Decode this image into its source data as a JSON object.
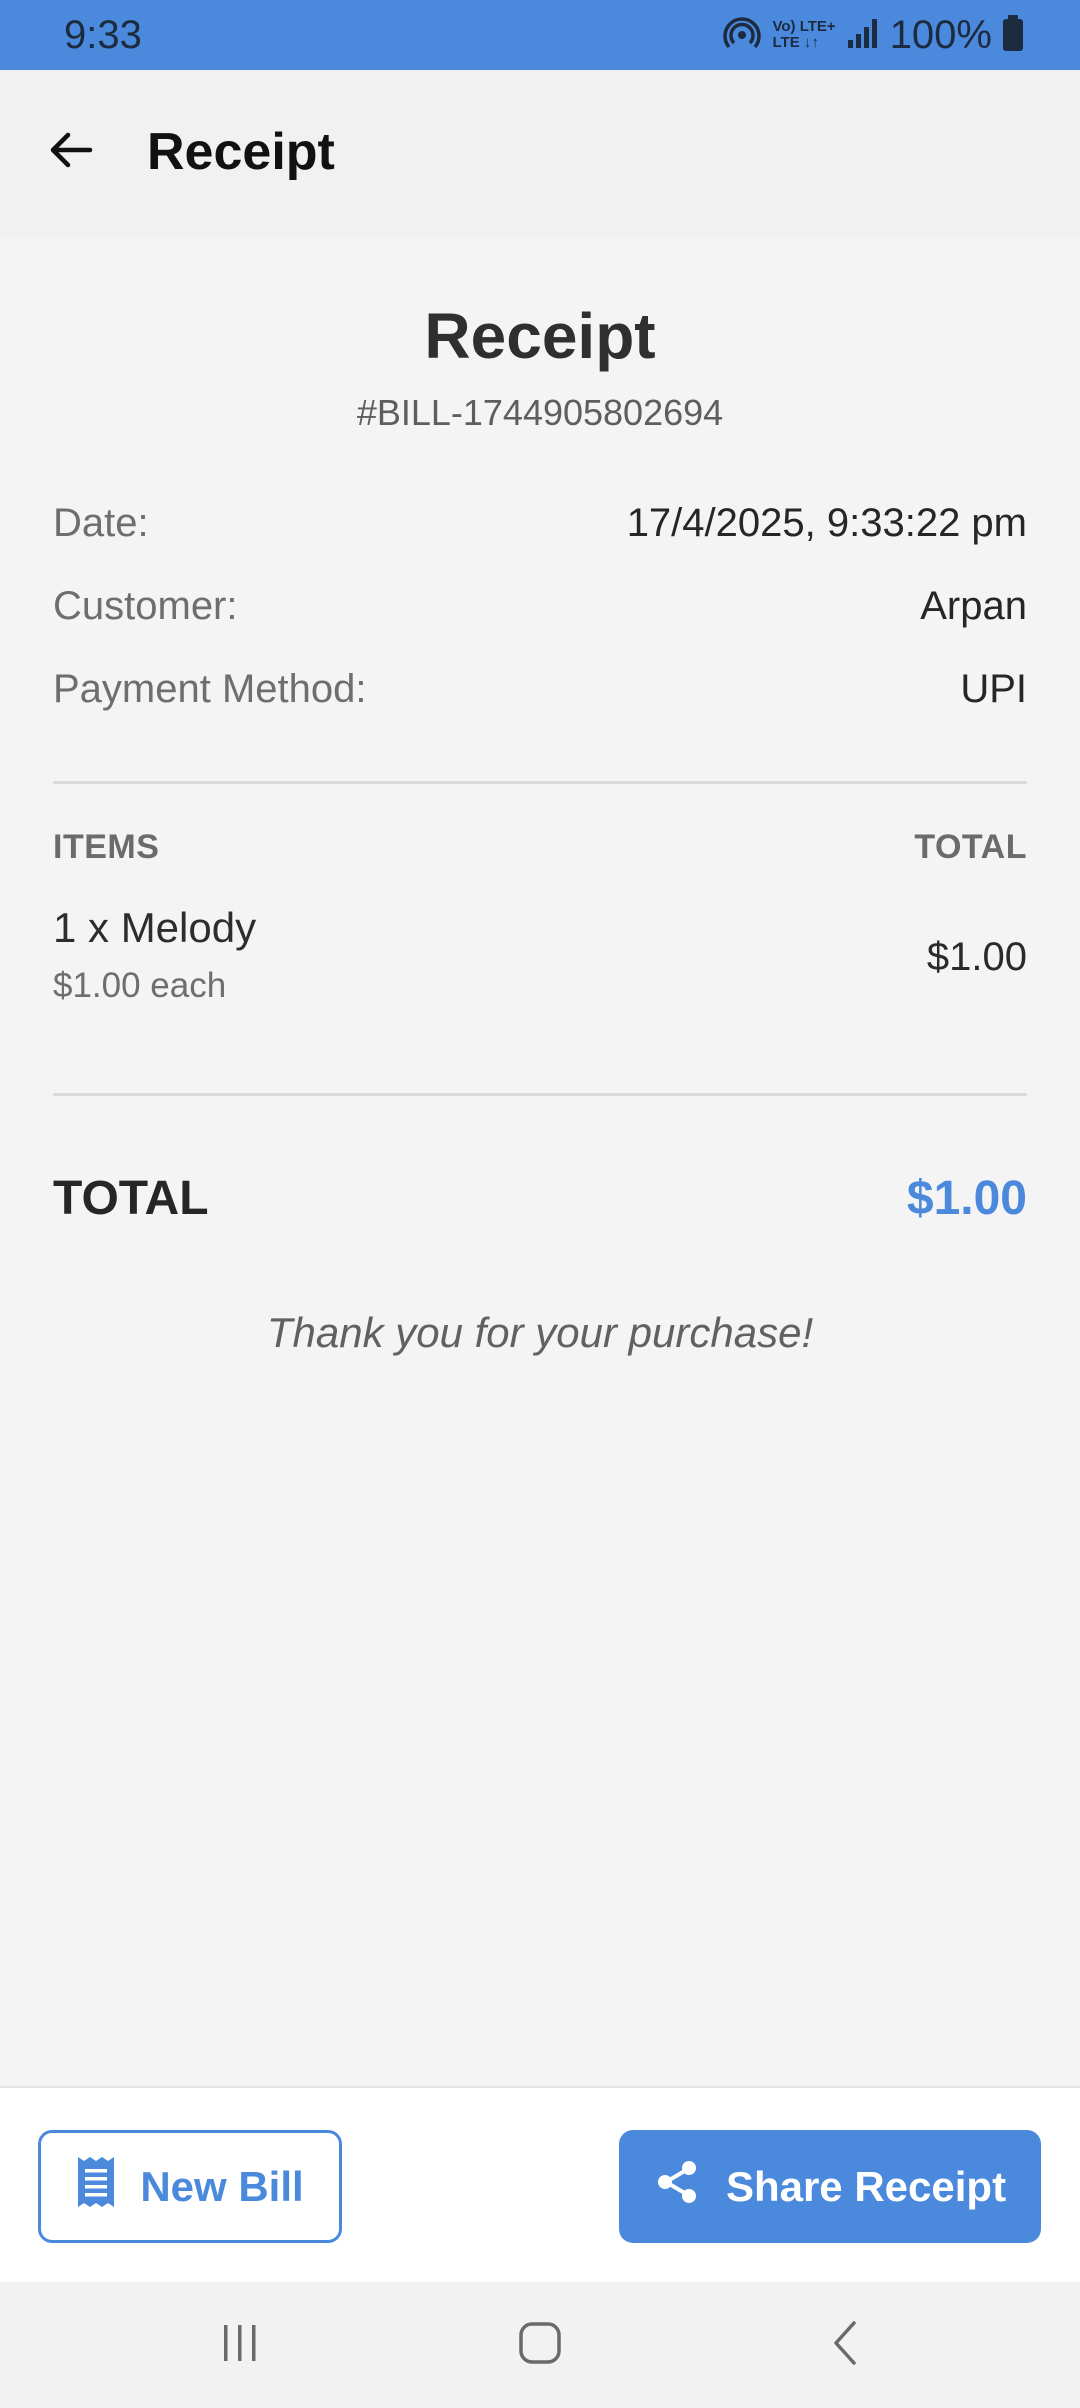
{
  "status_bar": {
    "time": "9:33",
    "lte_top": "Vo) LTE+",
    "lte_bottom": "LTE ↓↑",
    "battery": "100%",
    "icons": [
      "hotspot-icon",
      "volte-icon",
      "signal-icon",
      "battery-icon"
    ]
  },
  "app_bar": {
    "title": "Receipt",
    "back_icon": "arrow-left-icon"
  },
  "receipt": {
    "heading": "Receipt",
    "number": "#BILL-1744905802694",
    "date_label": "Date:",
    "date_value": "17/4/2025, 9:33:22 pm",
    "customer_label": "Customer:",
    "customer_value": "Arpan",
    "payment_label": "Payment Method:",
    "payment_value": "UPI",
    "items_header": "ITEMS",
    "total_header": "TOTAL",
    "items": [
      {
        "name": "1 x Melody",
        "unit_price": "$1.00 each",
        "total": "$1.00"
      }
    ],
    "grand_total_label": "TOTAL",
    "grand_total_value": "$1.00",
    "thank_you": "Thank you for your purchase!"
  },
  "actions": {
    "new_bill_label": "New Bill",
    "new_bill_icon": "receipt-icon",
    "share_label": "Share Receipt",
    "share_icon": "share-icon"
  },
  "navigation": {
    "icons": [
      "recent-apps-icon",
      "home-icon",
      "back-nav-icon"
    ]
  },
  "colors": {
    "accent": "#4a89dc",
    "background": "#f4f4f4",
    "text": "#2b2b2b"
  }
}
